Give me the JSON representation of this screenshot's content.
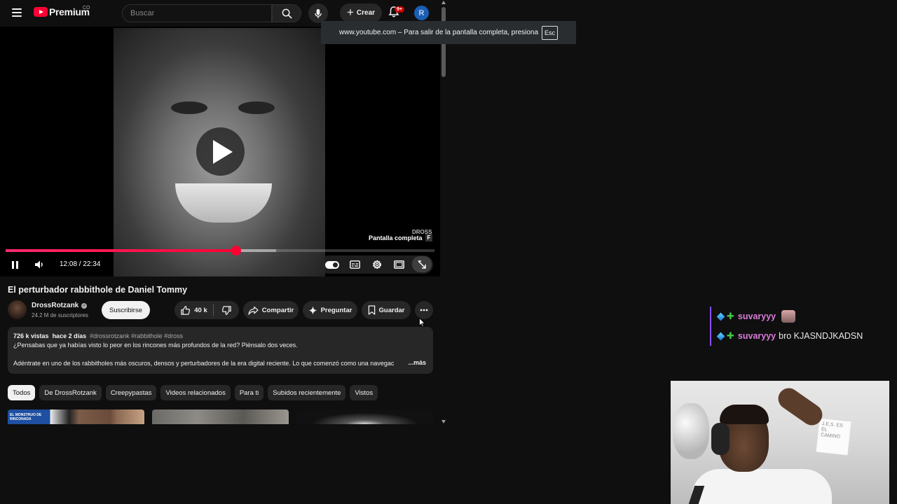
{
  "header": {
    "logo_text": "Premium",
    "logo_country": "CO",
    "search_placeholder": "Buscar",
    "create_label": "Crear",
    "notifications_badge": "9+",
    "avatar_letter": "R"
  },
  "fullscreen_notice": {
    "text": "www.youtube.com – Para salir de la pantalla completa, presiona",
    "key": "Esc"
  },
  "player": {
    "watermark": "DROSS",
    "tooltip_label": "Pantalla completa",
    "tooltip_key": "F",
    "time_display": "12:08 / 22:34",
    "progress_fraction": 0.537,
    "buffer_fraction": 0.63
  },
  "video": {
    "title": "El perturbador rabbithole de Daniel Tommy",
    "channel_name": "DrossRotzank",
    "subscribers": "24.2 M de suscriptores",
    "subscribe_label": "Suscribirse",
    "like_count": "40 k",
    "share_label": "Compartir",
    "ask_label": "Preguntar",
    "save_label": "Guardar"
  },
  "description": {
    "views": "726 k vistas",
    "date": "hace 2 días",
    "tags": "#drossrotzank #rabbithole #dross",
    "line1": "¿Pensabas que ya habías visto lo peor en los rincones más profundos de la red? Piénsalo dos veces.",
    "line2": "Adéntrate en uno de los rabbitholes más oscuros, densos y perturbadores de la era digital reciente. Lo que comenzó como una navegac",
    "more_label": "...más"
  },
  "chips": [
    {
      "label": "Todos",
      "active": true
    },
    {
      "label": "De DrossRotzank",
      "active": false
    },
    {
      "label": "Creepypastas",
      "active": false
    },
    {
      "label": "Videos relacionados",
      "active": false
    },
    {
      "label": "Para ti",
      "active": false
    },
    {
      "label": "Subidos recientemente",
      "active": false
    },
    {
      "label": "Vistos",
      "active": false
    }
  ],
  "thumbnail_1_text": "EL MONSTRUO DE RINCONADA",
  "chat": {
    "messages": [
      {
        "user": "suvaryyy",
        "text": ""
      },
      {
        "user": "suvaryyy",
        "text": "bro KJASNDJKADSN"
      }
    ]
  },
  "webcam": {
    "sign_text": "J.E.S. ES EL CAMINO"
  },
  "colors": {
    "accent_red": "#ff0033",
    "background": "#0f0f0f",
    "chat_username": "#d87bd8"
  }
}
